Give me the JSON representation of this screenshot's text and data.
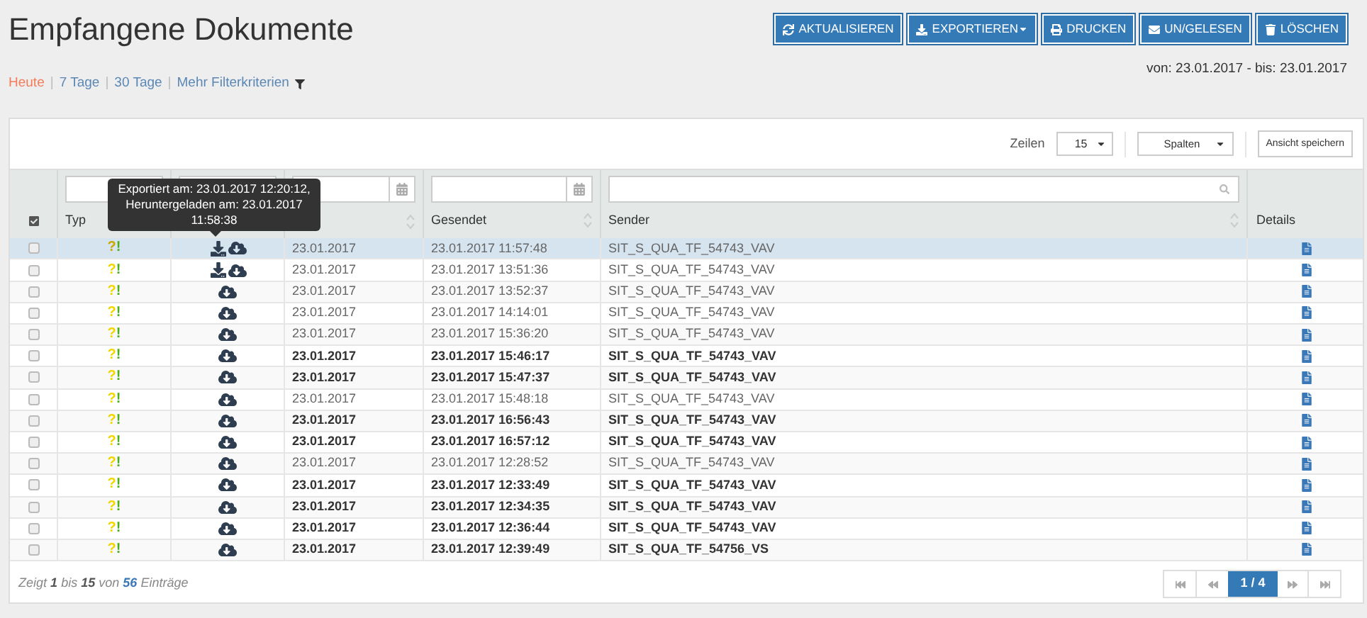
{
  "page": {
    "title": "Empfangene Dokumente"
  },
  "buttons": [
    {
      "label": "AKTUALISIEREN",
      "kind": "refresh",
      "dropdown": false
    },
    {
      "label": "EXPORTIEREN",
      "kind": "export",
      "dropdown": true
    },
    {
      "label": "DRUCKEN",
      "kind": "print",
      "dropdown": false
    },
    {
      "label": "UN/GELESEN",
      "kind": "mail",
      "dropdown": false
    },
    {
      "label": "LÖSCHEN",
      "kind": "delete",
      "dropdown": false
    }
  ],
  "quick_filters": [
    {
      "label": "Heute",
      "selected": true
    },
    {
      "label": "7 Tage",
      "selected": false
    },
    {
      "label": "30 Tage",
      "selected": false
    }
  ],
  "separator": "|",
  "more_filters": "Mehr Filterkriterien",
  "date_range": "von: 23.01.2017 - bis: 23.01.2017",
  "table_tools": {
    "rows_label": "Zeilen",
    "rows_value": "15",
    "columns_button": "Spalten",
    "save_view": "Ansicht speichern"
  },
  "table": {
    "columns": [
      "Typ",
      "Gesendet",
      "Sender",
      "Details"
    ],
    "rows": [
      {
        "selected": true,
        "unread": false,
        "exported": true,
        "type": [
          {
            "text": "?",
            "color": "#c9a800"
          },
          {
            "text": "!",
            "color": "#4cae1f"
          }
        ],
        "received": "23.01.2017",
        "sent": "23.01.2017 11:57:48",
        "sender": "SIT_S_QUA_TF_54743_VAV"
      },
      {
        "selected": false,
        "unread": false,
        "exported": true,
        "type": [
          {
            "text": "?",
            "color": "#f2d600"
          },
          {
            "text": "!",
            "color": "#4cae1f"
          }
        ],
        "received": "23.01.2017",
        "sent": "23.01.2017 13:51:36",
        "sender": "SIT_S_QUA_TF_54743_VAV"
      },
      {
        "selected": false,
        "unread": false,
        "exported": false,
        "type": [
          {
            "text": "?",
            "color": "#f2d600"
          },
          {
            "text": "!",
            "color": "#4cae1f"
          }
        ],
        "received": "23.01.2017",
        "sent": "23.01.2017 13:52:37",
        "sender": "SIT_S_QUA_TF_54743_VAV"
      },
      {
        "selected": false,
        "unread": false,
        "exported": false,
        "type": [
          {
            "text": "?",
            "color": "#f2d600"
          },
          {
            "text": "!",
            "color": "#4cae1f"
          }
        ],
        "received": "23.01.2017",
        "sent": "23.01.2017 14:14:01",
        "sender": "SIT_S_QUA_TF_54743_VAV"
      },
      {
        "selected": false,
        "unread": false,
        "exported": false,
        "type": [
          {
            "text": "?",
            "color": "#f2d600"
          },
          {
            "text": "!",
            "color": "#4cae1f"
          }
        ],
        "received": "23.01.2017",
        "sent": "23.01.2017 15:36:20",
        "sender": "SIT_S_QUA_TF_54743_VAV"
      },
      {
        "selected": false,
        "unread": true,
        "exported": false,
        "type": [
          {
            "text": "?",
            "color": "#f2d600"
          },
          {
            "text": "!",
            "color": "#4cae1f"
          }
        ],
        "received": "23.01.2017",
        "sent": "23.01.2017 15:46:17",
        "sender": "SIT_S_QUA_TF_54743_VAV"
      },
      {
        "selected": false,
        "unread": true,
        "exported": false,
        "type": [
          {
            "text": "?",
            "color": "#f2d600"
          },
          {
            "text": "!",
            "color": "#4cae1f"
          }
        ],
        "received": "23.01.2017",
        "sent": "23.01.2017 15:47:37",
        "sender": "SIT_S_QUA_TF_54743_VAV"
      },
      {
        "selected": false,
        "unread": false,
        "exported": false,
        "type": [
          {
            "text": "?",
            "color": "#f2d600"
          },
          {
            "text": "!",
            "color": "#4cae1f"
          }
        ],
        "received": "23.01.2017",
        "sent": "23.01.2017 15:48:18",
        "sender": "SIT_S_QUA_TF_54743_VAV"
      },
      {
        "selected": false,
        "unread": true,
        "exported": false,
        "type": [
          {
            "text": "?",
            "color": "#f2d600"
          },
          {
            "text": "!",
            "color": "#4cae1f"
          }
        ],
        "received": "23.01.2017",
        "sent": "23.01.2017 16:56:43",
        "sender": "SIT_S_QUA_TF_54743_VAV"
      },
      {
        "selected": false,
        "unread": true,
        "exported": false,
        "type": [
          {
            "text": "?",
            "color": "#f2d600"
          },
          {
            "text": "!",
            "color": "#4cae1f"
          }
        ],
        "received": "23.01.2017",
        "sent": "23.01.2017 16:57:12",
        "sender": "SIT_S_QUA_TF_54743_VAV"
      },
      {
        "selected": false,
        "unread": false,
        "exported": false,
        "type": [
          {
            "text": "?",
            "color": "#f2d600"
          },
          {
            "text": "!",
            "color": "#4cae1f"
          }
        ],
        "received": "23.01.2017",
        "sent": "23.01.2017 12:28:52",
        "sender": "SIT_S_QUA_TF_54743_VAV"
      },
      {
        "selected": false,
        "unread": true,
        "exported": false,
        "type": [
          {
            "text": "?",
            "color": "#f2d600"
          },
          {
            "text": "!",
            "color": "#4cae1f"
          }
        ],
        "received": "23.01.2017",
        "sent": "23.01.2017 12:33:49",
        "sender": "SIT_S_QUA_TF_54743_VAV"
      },
      {
        "selected": false,
        "unread": true,
        "exported": false,
        "type": [
          {
            "text": "?",
            "color": "#f2d600"
          },
          {
            "text": "!",
            "color": "#4cae1f"
          }
        ],
        "received": "23.01.2017",
        "sent": "23.01.2017 12:34:35",
        "sender": "SIT_S_QUA_TF_54743_VAV"
      },
      {
        "selected": false,
        "unread": true,
        "exported": false,
        "type": [
          {
            "text": "?",
            "color": "#f2d600"
          },
          {
            "text": "!",
            "color": "#4cae1f"
          }
        ],
        "received": "23.01.2017",
        "sent": "23.01.2017 12:36:44",
        "sender": "SIT_S_QUA_TF_54743_VAV"
      },
      {
        "selected": false,
        "unread": true,
        "exported": false,
        "type": [
          {
            "text": "?",
            "color": "#f2d600"
          },
          {
            "text": "!",
            "color": "#4cae1f"
          }
        ],
        "received": "23.01.2017",
        "sent": "23.01.2017 12:39:49",
        "sender": "SIT_S_QUA_TF_54756_VS"
      }
    ]
  },
  "tooltip": "Exportiert am: 23.01.2017 12:20:12, Heruntergeladen am: 23.01.2017 11:58:38",
  "footer": {
    "prefix": "Zeigt",
    "from": "1",
    "word_to": "bis",
    "to": "15",
    "word_of": "von",
    "total": "56",
    "suffix": "Einträge"
  },
  "pagination": {
    "page": "1 / 4"
  }
}
